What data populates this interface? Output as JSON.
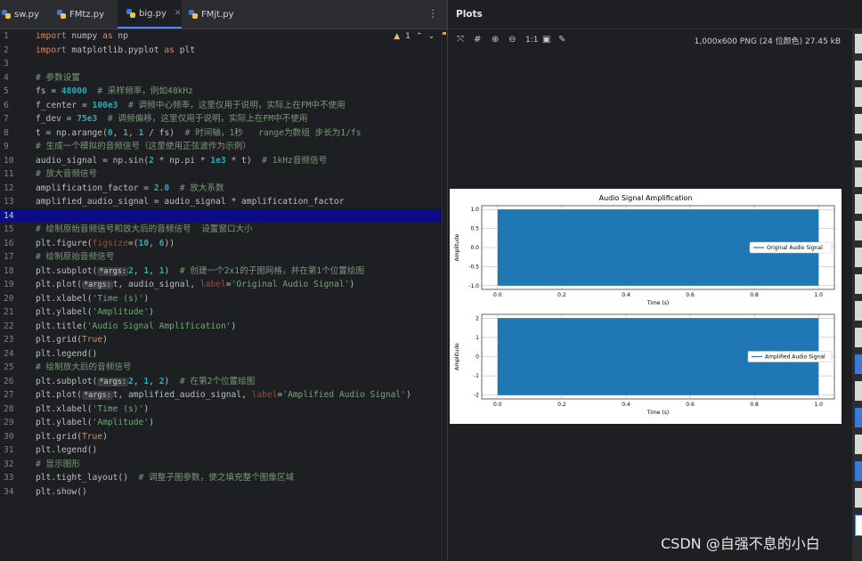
{
  "tabs": [
    {
      "label": "sw.py"
    },
    {
      "label": "FMtz.py"
    },
    {
      "label": "big.py"
    },
    {
      "label": "FMjt.py"
    }
  ],
  "editor": {
    "warning_count": "1",
    "line_numbers": [
      "1",
      "2",
      "3",
      "4",
      "5",
      "6",
      "7",
      "8",
      "9",
      "10",
      "11",
      "12",
      "13",
      "14",
      "15",
      "16",
      "17",
      "18",
      "19",
      "20",
      "21",
      "22",
      "23",
      "24",
      "25",
      "26",
      "27",
      "28",
      "29",
      "30",
      "31",
      "32",
      "33",
      "34"
    ],
    "code": {
      "l1_a": "import",
      "l1_b": " numpy ",
      "l1_c": "as",
      "l1_d": " np",
      "l2_a": "import",
      "l2_b": " matplotlib.pyplot ",
      "l2_c": "as",
      "l2_d": " plt",
      "l4": "# 参数设置",
      "l5_a": "fs = ",
      "l5_b": "48000",
      "l5_c": "  # 采样频率，例如48kHz",
      "l6_a": "f_center = ",
      "l6_b": "100e3",
      "l6_c": "  # 调频中心频率，这里仅用于说明，实际上在FM中不使用",
      "l7_a": "f_dev = ",
      "l7_b": "75e3",
      "l7_c": "  # 调频偏移，这里仅用于说明，实际上在FM中不使用",
      "l8_a": "t = np.arange(",
      "l8_b": "0",
      "l8_c": ", ",
      "l8_d": "1",
      "l8_e": ", ",
      "l8_f": "1",
      "l8_g": " / fs)  ",
      "l8_h": "# 时间轴，1秒   range为数组 步长为1/fs",
      "l9": "# 生成一个模拟的音频信号（这里使用正弦波作为示例）",
      "l10_a": "audio_signal = np.sin(",
      "l10_b": "2",
      "l10_c": " * np.pi * ",
      "l10_d": "1e3",
      "l10_e": " * t)  ",
      "l10_f": "# 1kHz音频信号",
      "l11": "# 放大音频信号",
      "l12_a": "amplification_factor = ",
      "l12_b": "2.0",
      "l12_c": "  # 放大系数",
      "l13": "amplified_audio_signal = audio_signal * amplification_factor",
      "l15": "# 绘制原始音频信号和放大后的音频信号  设置窗口大小",
      "l16_a": "plt.figure(",
      "l16_b": "figsize",
      "l16_c": "=(",
      "l16_d": "10",
      "l16_e": ", ",
      "l16_f": "6",
      "l16_g": "))",
      "l17": "# 绘制原始音频信号",
      "l18_a": "plt.subplot(",
      "l18_h": "*args:",
      "l18_b": "2",
      "l18_c": ", ",
      "l18_d": "1",
      "l18_e": ", ",
      "l18_f": "1",
      "l18_g": ")  ",
      "l18_i": "# 创建一个2x1的子图网格，并在第1个位置绘图",
      "l19_a": "plt.plot(",
      "l19_h": "*args:",
      "l19_b": "t, audio_signal, ",
      "l19_c": "label",
      "l19_d": "=",
      "l19_e": "'Original Audio Signal'",
      "l19_f": ")",
      "l20_a": "plt.xlabel(",
      "l20_b": "'Time (s)'",
      "l20_c": ")",
      "l21_a": "plt.ylabel(",
      "l21_b": "'Amplitude'",
      "l21_c": ")",
      "l22_a": "plt.title(",
      "l22_b": "'Audio Signal Amplification'",
      "l22_c": ")",
      "l23_a": "plt.grid(",
      "l23_b": "True",
      "l23_c": ")",
      "l24": "plt.legend()",
      "l25": "# 绘制放大后的音频信号",
      "l26_a": "plt.subplot(",
      "l26_h": "*args:",
      "l26_b": "2",
      "l26_c": ", ",
      "l26_d": "1",
      "l26_e": ", ",
      "l26_f": "2",
      "l26_g": ")  ",
      "l26_i": "# 在第2个位置绘图",
      "l27_a": "plt.plot(",
      "l27_h": "*args:",
      "l27_b": "t, amplified_audio_signal, ",
      "l27_c": "label",
      "l27_d": "=",
      "l27_e": "'Amplified Audio Signal'",
      "l27_f": ")",
      "l28_a": "plt.xlabel(",
      "l28_b": "'Time (s)'",
      "l28_c": ")",
      "l29_a": "plt.ylabel(",
      "l29_b": "'Amplitude'",
      "l29_c": ")",
      "l30_a": "plt.grid(",
      "l30_b": "True",
      "l30_c": ")",
      "l31": "plt.legend()",
      "l32": "# 显示图形",
      "l33_a": "plt.tight_layout()  ",
      "l33_b": "# 调整子图参数，使之填充整个图像区域",
      "l34": "plt.show()"
    }
  },
  "plots_panel": {
    "title": "Plots",
    "zoom_label": "1:1",
    "image_info": "1,000x600 PNG (24 位颜色) 27.45 kB"
  },
  "chart_data": {
    "type": "area",
    "title": "Audio Signal Amplification",
    "subplots": [
      {
        "xlabel": "Time (s)",
        "ylabel": "Amplitude",
        "xlim": [
          0.0,
          1.0
        ],
        "ylim": [
          -1.0,
          1.0
        ],
        "xticks": [
          "0.0",
          "0.2",
          "0.4",
          "0.6",
          "0.8",
          "1.0"
        ],
        "yticks": [
          "1.0",
          "0.5",
          "0.0",
          "-0.5",
          "-1.0"
        ],
        "series": [
          {
            "name": "Original Audio Signal",
            "x": [
              0.0,
              1.0
            ],
            "y_min": -1.0,
            "y_max": 1.0
          }
        ],
        "grid": true,
        "legend": "right"
      },
      {
        "xlabel": "Time (s)",
        "ylabel": "Amplitude",
        "xlim": [
          0.0,
          1.0
        ],
        "ylim": [
          -2.0,
          2.0
        ],
        "xticks": [
          "0.0",
          "0.2",
          "0.4",
          "0.6",
          "0.8",
          "1.0"
        ],
        "yticks": [
          "2",
          "1",
          "0",
          "-1",
          "-2"
        ],
        "series": [
          {
            "name": "Amplified Audio Signal",
            "x": [
              0.0,
              1.0
            ],
            "y_min": -2.0,
            "y_max": 2.0
          }
        ],
        "grid": true,
        "legend": "right"
      }
    ],
    "color": "#1f77b4"
  },
  "watermark": "CSDN @自强不息的小白"
}
